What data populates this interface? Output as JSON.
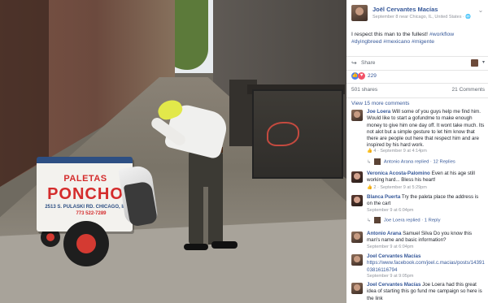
{
  "photo": {
    "cart_brand_top": "PALETAS",
    "cart_brand": "PONCHO",
    "cart_address": "2513 S. PULASKI RD. CHICAGO, IL",
    "cart_phone": "773 522-7289"
  },
  "post": {
    "author": "Joël Cervantes Macías",
    "meta": "September 8 near Chicago, IL, United States · 🌐",
    "text": "I respect this man to the fullest!",
    "tags": "#workflow #dyingbreed #mexicano #migente",
    "share_label": "Share",
    "reaction_count": "229",
    "shares": "501 shares",
    "comments_count": "21 Comments",
    "view_more": "View 15 more comments"
  },
  "comments": [
    {
      "name": "Joe Loera",
      "text": "Will some of you guys help me find him. Would like to start a gofundme to make enough money to give him one day off. It wont take much. Its not alot but a simple gesture to let him know that there are people out here that respect him and are inspired by his hard work.",
      "meta_likes": "4",
      "meta_time": "September 9 at 4:14pm",
      "reply": "Antonio Arana replied · 12 Replies"
    },
    {
      "name": "Veronica Acosta-Palomino",
      "text": "Even at his age still working hard... Bless his heart!",
      "meta_likes": "2",
      "meta_time": "September 9 at 5:29pm"
    },
    {
      "name": "Blanca Puerta",
      "text": "Try the paleta place the address is on the cart",
      "meta_time": "September 9 at 6:04pm",
      "reply": "Joe Loera replied · 1 Reply"
    },
    {
      "name": "Antonio Arana",
      "text": "Samuel Silva Do you know this man's name and basic information?",
      "meta_time": "September 9 at 6:04pm"
    },
    {
      "name": "Joel Cervantes Macías",
      "link": "https://www.facebook.com/joel.c.macias/posts/143910381611​6794",
      "meta_time": "September 9 at 9:05pm"
    },
    {
      "name": "Joel Cervantes Macías",
      "text": "Joe Loera had this great idea of starting this go fund me campaign so here is the link"
    }
  ],
  "labels": {
    "like": "Like",
    "reply": "Reply"
  }
}
